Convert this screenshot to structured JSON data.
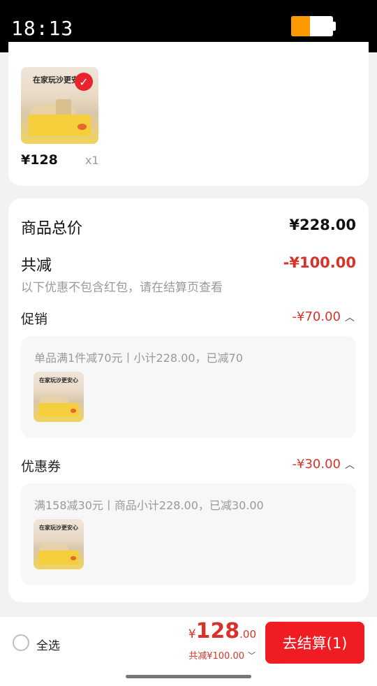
{
  "status_bar": {
    "time": "18:13",
    "battery_level": 0.45
  },
  "cart_item": {
    "image_headline": "在家玩沙更安心",
    "price": "¥128",
    "quantity": "x1",
    "selected": true
  },
  "summary": {
    "total_label": "商品总价",
    "total_value": "¥228.00",
    "discount_label": "共减",
    "discount_value": "-¥100.00",
    "discount_note": "以下优惠不包含红包，请在结算页查看",
    "promotion": {
      "label": "促销",
      "value": "-¥70.00",
      "detail": "单品满1件减70元丨小计228.00，已减70"
    },
    "coupon": {
      "label": "优惠券",
      "value": "-¥30.00",
      "detail": "满158减30元丨商品小计228.00，已减30.00"
    }
  },
  "bottom_bar": {
    "select_all_label": "全选",
    "currency_symbol": "¥",
    "total_integer": "128",
    "total_decimal": ".00",
    "discount_summary": "共减¥100.00",
    "checkout_label": "去结算(1)"
  },
  "colors": {
    "accent_red": "#ef1c24",
    "price_red": "#d8332a",
    "battery": "#ff9900"
  },
  "icons": [
    "battery-icon",
    "check-icon",
    "chevron-up-icon",
    "chevron-down-icon",
    "radio-icon"
  ]
}
